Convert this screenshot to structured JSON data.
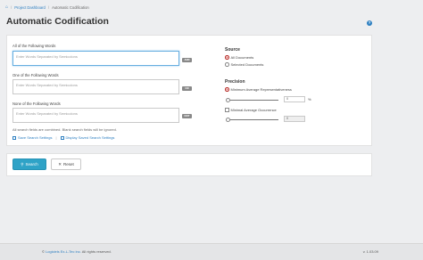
{
  "breadcrumb": {
    "home_icon": "home-icon",
    "items": [
      "Project Dashboard",
      "Automatic Codification"
    ]
  },
  "page": {
    "title": "Automatic Codification",
    "help_icon": "question-circle-icon"
  },
  "search": {
    "all_words_label": "All of the Following Words",
    "all_words_placeholder": "Enter Words Separated by Semicolons",
    "all_words_value": "",
    "all_words_operator": "AND",
    "one_word_label": "One of the Following Words",
    "one_word_placeholder": "Enter Words Separated by Semicolons",
    "one_word_value": "",
    "one_word_operator": "OR",
    "none_words_label": "None of the Following Words",
    "none_words_placeholder": "Enter Words Separated by Semicolons",
    "none_words_value": "",
    "none_words_operator": "NOT",
    "note": "All search fields are combined. Blank search fields will be ignored.",
    "save_settings_link": "Save Search Settings",
    "display_saved_link": "Display Saved Search Settings"
  },
  "source": {
    "heading": "Source",
    "options": [
      "All Documents",
      "Selected Documents"
    ],
    "selected": "All Documents"
  },
  "precision": {
    "heading": "Precision",
    "min_avg_label": "Minimum Average Representativeness",
    "min_avg_selected": true,
    "min_avg_value": "0",
    "min_avg_unit": "%",
    "minimal_occ_label": "Minimal Average Occurrence",
    "minimal_occ_checked": false,
    "minimal_occ_value": "0"
  },
  "actions": {
    "search_label": "Search",
    "reset_label": "Reset"
  },
  "footer": {
    "copyright_prefix": "©",
    "company": "Logiciels Ex-L-Tec inc.",
    "rights": "All rights reserved.",
    "version": "v. 1.03.09"
  },
  "colors": {
    "accent": "#2d7fc1",
    "primary_button": "#2fa3c7",
    "radio_selected": "#d9534f"
  }
}
